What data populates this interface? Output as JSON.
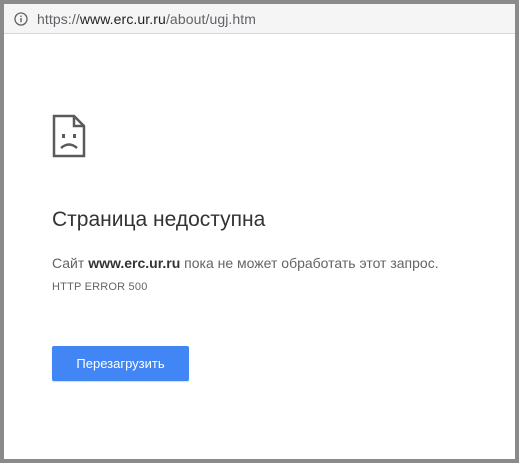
{
  "browser": {
    "url_prefix": "https://",
    "url_host": "www.erc.ur.ru",
    "url_path": "/about/ugj.htm",
    "info_icon": "info-icon"
  },
  "error_page": {
    "icon": "sad-page-icon",
    "title": "Страница недоступна",
    "description_before": "Сайт ",
    "description_host": "www.erc.ur.ru",
    "description_after": " пока не может обработать этот запрос.",
    "error_code": "HTTP ERROR 500",
    "reload_label": "Перезагрузить",
    "accent_color": "#4285f4"
  }
}
